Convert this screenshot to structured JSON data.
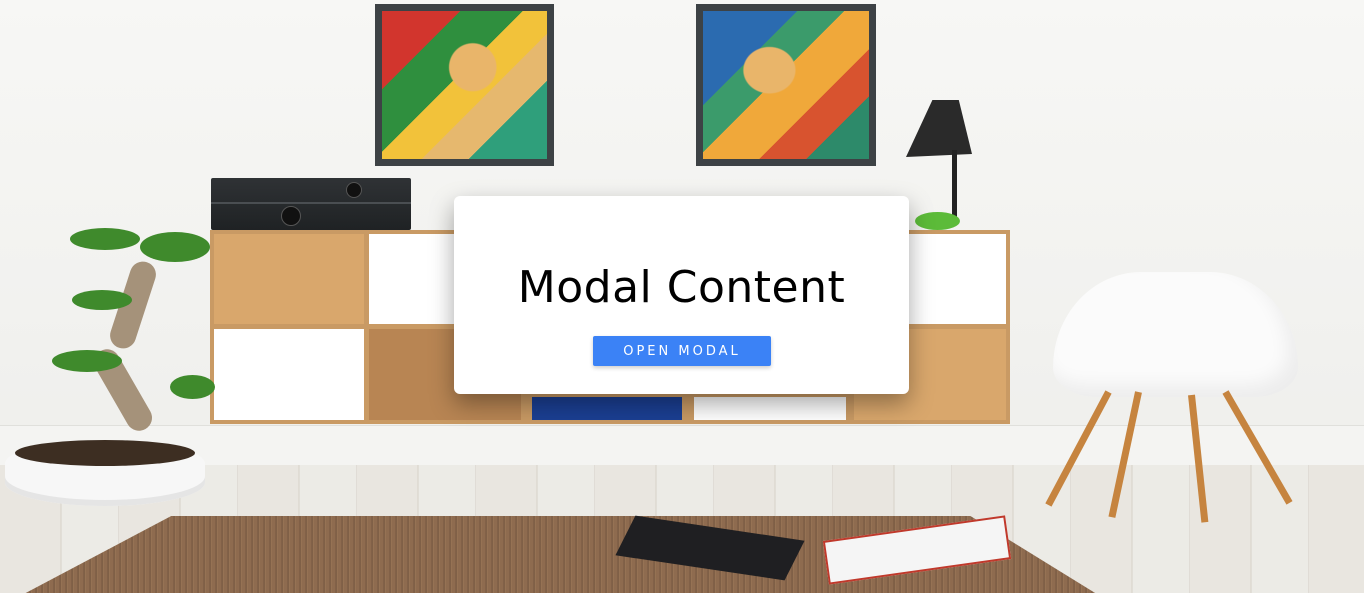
{
  "modal": {
    "title": "Modal Content",
    "button_label": "OPEN MODAL"
  },
  "colors": {
    "modal_bg": "#ffffff",
    "button_bg": "#3b82f6",
    "button_text": "#ffffff",
    "title_text": "#000000"
  }
}
